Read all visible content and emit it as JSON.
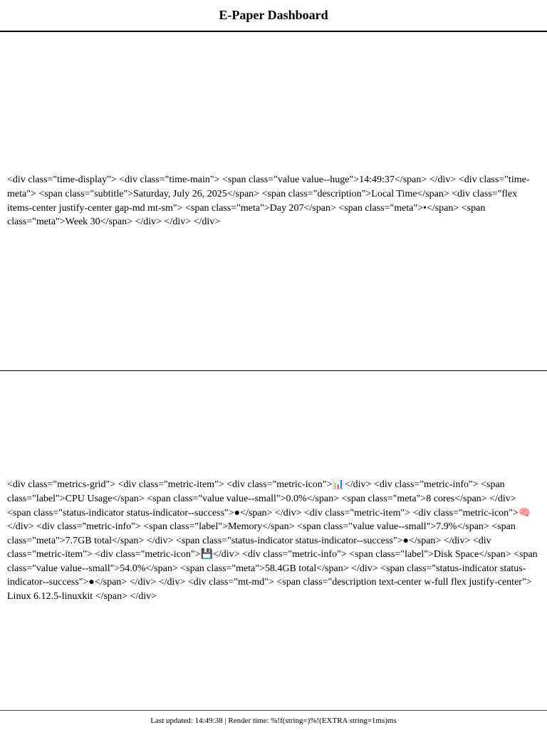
{
  "header": {
    "title": "E-Paper Dashboard"
  },
  "time_panel": {
    "raw_markup_text": "<div class=\"time-display\"> <div class=\"time-main\"> <span class=\"value value--huge\">14:49:37</span> </div> <div class=\"time-meta\"> <span class=\"subtitle\">Saturday, July 26, 2025</span> <span class=\"description\">Local Time</span> <div class=\"flex items-center justify-center gap-md mt-sm\"> <span class=\"meta\">Day 207</span> <span class=\"meta\">•</span> <span class=\"meta\">Week 30</span> </div> </div> </div>"
  },
  "metrics_panel": {
    "seg1": "<div class=\"metrics-grid\"> <div class=\"metric-item\"> <div class=\"metric-icon\">",
    "icon_cpu": "📊",
    "seg2": "</div> <div class=\"metric-info\"> <span class=\"label\">CPU Usage</span> <span class=\"value value--small\">0.0%</span> <span class=\"meta\">8 cores</span> </div> <span class=\"status-indicator status-indicator--success\">●</span> </div> <div class=\"metric-item\"> <div class=\"metric-icon\">",
    "icon_memory": "🧠",
    "seg3": "</div> <div class=\"metric-info\"> <span class=\"label\">Memory</span> <span class=\"value value--small\">7.9%</span> <span class=\"meta\">7.7GB total</span> </div> <span class=\"status-indicator status-indicator--success\">●</span> </div> <div class=\"metric-item\"> <div class=\"metric-icon\">",
    "icon_disk": "💾",
    "seg4": "</div> <div class=\"metric-info\"> <span class=\"label\">Disk Space</span> <span class=\"value value--small\">54.0%</span> <span class=\"meta\">58.4GB total</span> </div> <span class=\"status-indicator status-indicator--success\">●</span> </div> </div> <div class=\"mt-md\"> <span class=\"description text-center w-full flex justify-center\"> Linux 6.12.5-linuxkit </span> </div>",
    "icons": [
      "bar-chart-icon",
      "brain-icon",
      "floppy-disk-icon"
    ]
  },
  "footer": {
    "text": "Last updated: 14:49:38 | Render time: %!f(string=)%!(EXTRA string=1ms)ms"
  }
}
